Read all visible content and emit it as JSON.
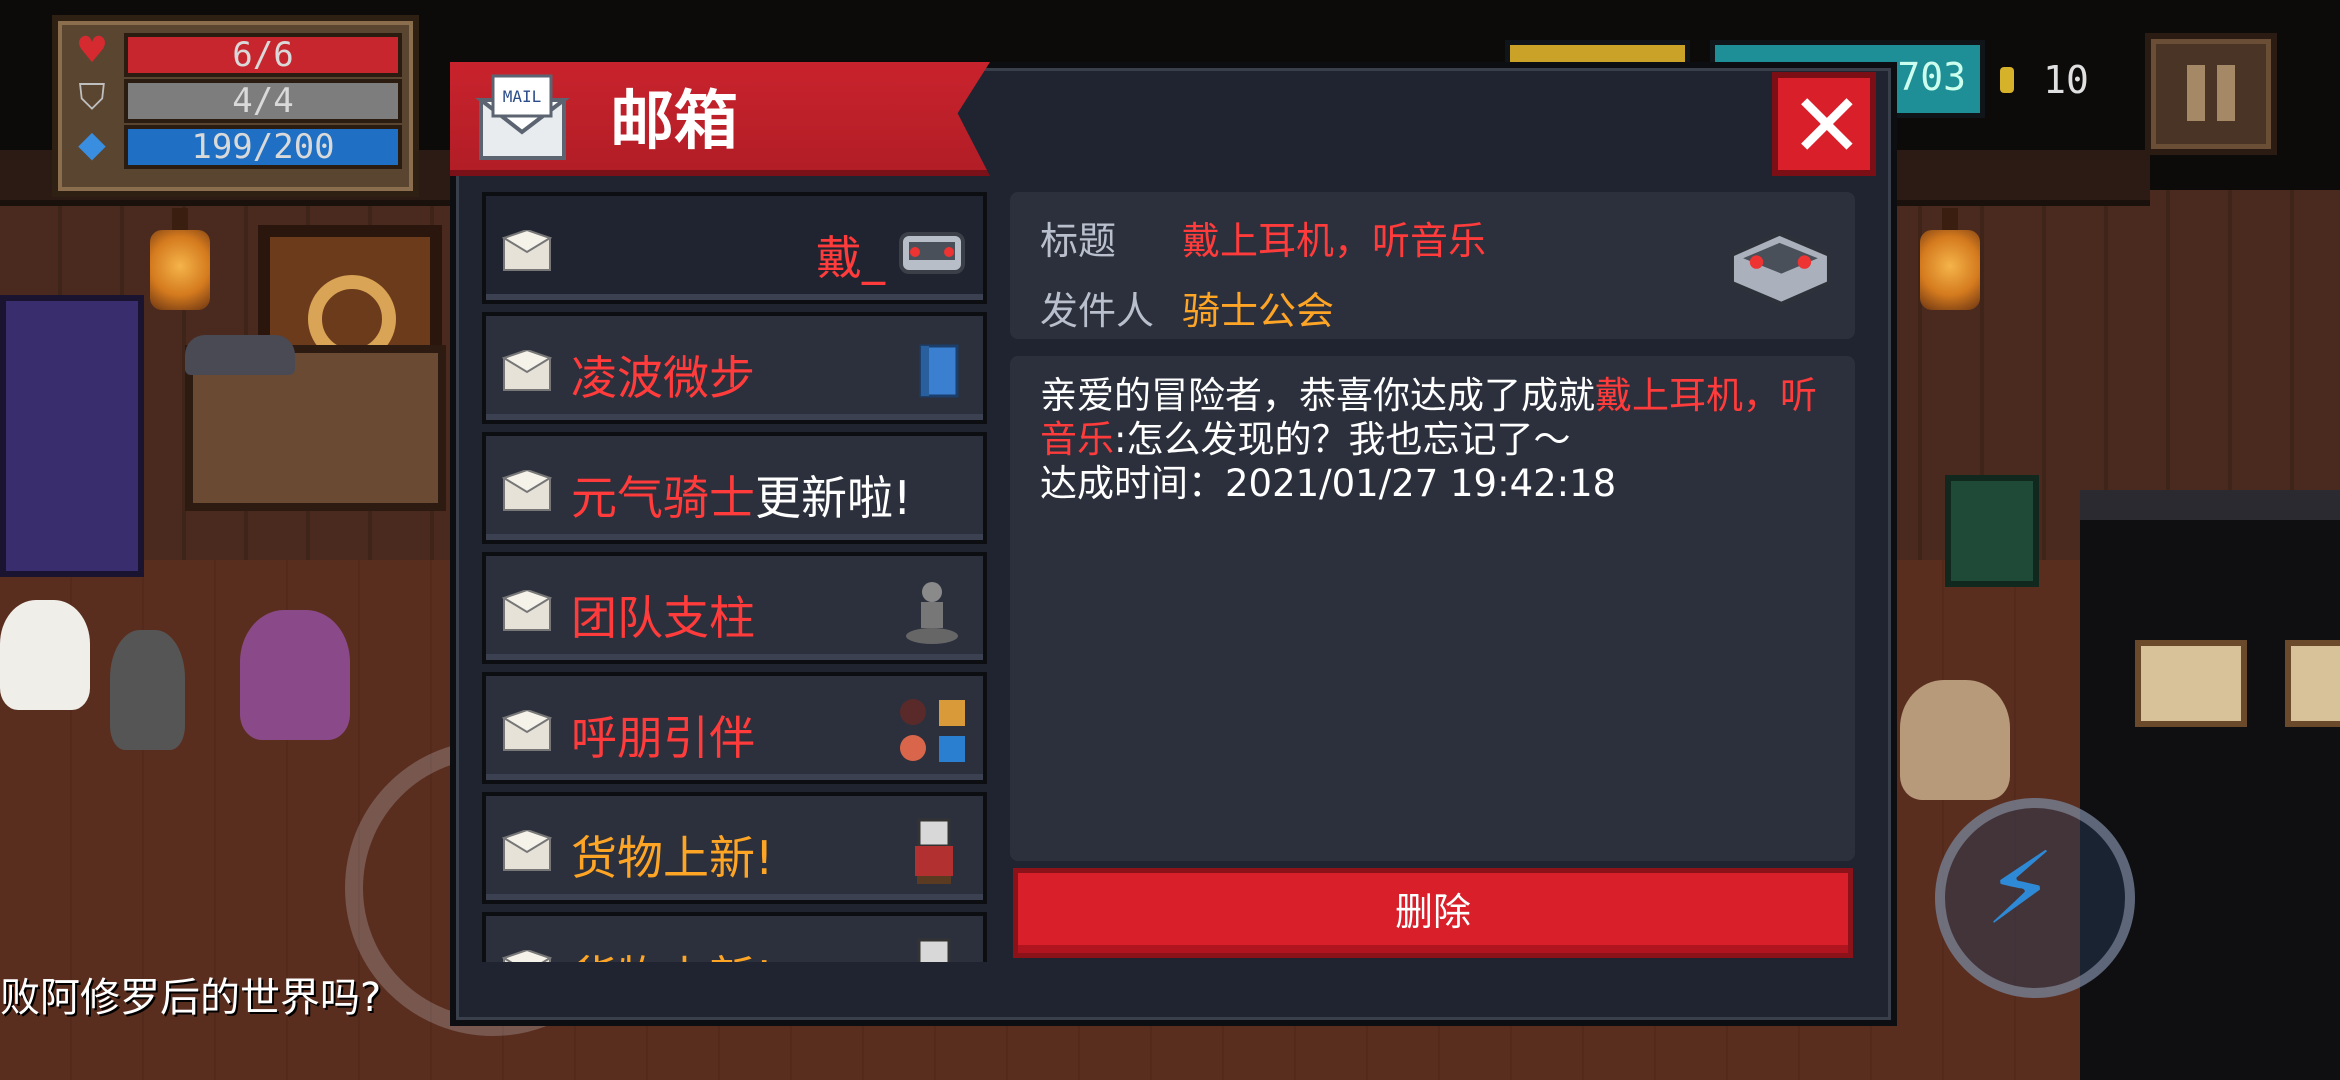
{
  "hud": {
    "health": "6/6",
    "armor": "4/4",
    "energy": "199/200",
    "gems": "703",
    "coins": "10",
    "colors": {
      "health": "#c8262e",
      "armor": "#7d7d7d",
      "energy": "#1f6fc4"
    }
  },
  "mailbox": {
    "title": "邮箱",
    "close_icon": "close-icon",
    "items": [
      {
        "title": "戴_",
        "color": "#ff3b3b",
        "thumb": "headphones-icon",
        "selected": true
      },
      {
        "title": "凌波微步",
        "color": "#ff3b3b",
        "thumb": "book-icon"
      },
      {
        "title_red": "元气骑士",
        "title_white": "更新啦!",
        "color": "#ff3b3b"
      },
      {
        "title": "团队支柱",
        "color": "#ff3b3b",
        "thumb": "statue-icon"
      },
      {
        "title": "呼朋引伴",
        "color": "#ff3b3b",
        "thumb": "friends-icon"
      },
      {
        "title": "货物上新!",
        "color": "#ffa526",
        "thumb": "merchant-icon"
      },
      {
        "title": "货物上新!",
        "color": "#ffa526",
        "thumb": "merchant-icon"
      }
    ],
    "detail": {
      "title_label": "标题",
      "title_value": "戴上耳机，听音乐",
      "sender_label": "发件人",
      "sender_value": "骑士公会",
      "body_prefix": "亲爱的冒险者，恭喜你达成了成就",
      "body_highlight": "戴上耳机，听音乐",
      "body_suffix": ":怎么发现的？我也忘记了～",
      "achieved_line": "达成时间：2021/01/27 19:42:18",
      "thumb": "headphones-icon"
    },
    "delete_label": "删除"
  },
  "subtitle": "败阿修罗后的世界吗?"
}
